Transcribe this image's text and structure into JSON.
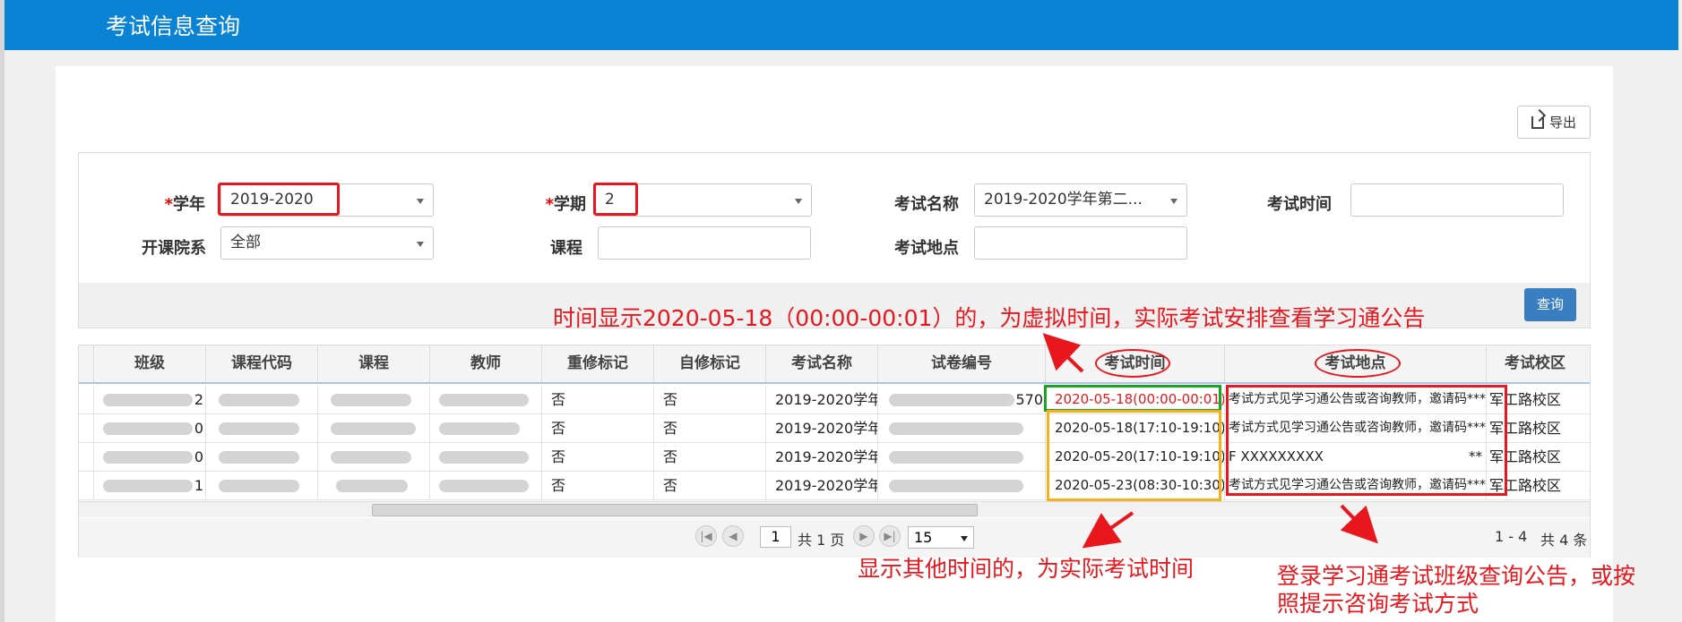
{
  "header": {
    "title": "考试信息查询"
  },
  "toolbar": {
    "export_label": "导出"
  },
  "filters": {
    "year_label": "学年",
    "year_value": "2019-2020",
    "term_label": "学期",
    "term_value": "2",
    "exam_name_label": "考试名称",
    "exam_name_value": "2019-2020学年第二...",
    "exam_time_label": "考试时间",
    "exam_time_value": "",
    "dept_label": "开课院系",
    "dept_value": "全部",
    "course_label": "课程",
    "course_value": "",
    "location_label": "考试地点",
    "location_value": "",
    "required_mark": "*"
  },
  "query_label": "查询",
  "annotations": {
    "top": "时间显示2020-05-18（00:00-00:01）的，为虚拟时间，实际考试安排查看学习通公告",
    "bottom_left": "显示其他时间的，为实际考试时间",
    "bottom_right_1": "登录学习通考试班级查询公告，或按",
    "bottom_right_2": "照提示咨询考试方式"
  },
  "table": {
    "columns": [
      "班级",
      "课程代码",
      "课程",
      "教师",
      "重修标记",
      "自修标记",
      "考试名称",
      "试卷编号",
      "考试时间",
      "考试地点",
      "考试校区"
    ],
    "rows": [
      {
        "class_suffix": "2",
        "code_suffix": "",
        "retake": "否",
        "self": "否",
        "exam_name": "2019-2020学年第",
        "paper": "570",
        "time": "2020-05-18(00:00-00:01)",
        "place": "考试方式见学习通公告或咨询教师，邀请码***",
        "campus": "军工路校区"
      },
      {
        "class_suffix": "0",
        "code_suffix": "",
        "retake": "否",
        "self": "否",
        "exam_name": "2019-2020学年第",
        "paper": "",
        "time": "2020-05-18(17:10-19:10)",
        "place": "考试方式见学习通公告或咨询教师，邀请码***",
        "campus": "军工路校区"
      },
      {
        "class_suffix": "0",
        "code_suffix": "",
        "retake": "否",
        "self": "否",
        "exam_name": "2019-2020学年第",
        "paper": "",
        "time": "2020-05-20(17:10-19:10)",
        "place": "F XXXXXXXXX",
        "place_tail": "**",
        "campus": "军工路校区"
      },
      {
        "class_suffix": "1",
        "code_suffix": "",
        "retake": "否",
        "self": "否",
        "exam_name": "2019-2020学年第",
        "paper": "",
        "time": "2020-05-23(08:30-10:30)",
        "place": "考试方式见学习通公告或咨询教师，邀请码***",
        "campus": "军工路校区"
      }
    ]
  },
  "pager": {
    "page": "1",
    "total_pages": "共 1 页",
    "page_size": "15",
    "range": "1 - 4",
    "total": "共 4 条"
  },
  "colors": {
    "accent": "#0a83d4",
    "annotation": "#e8171d",
    "green_box": "#19a51f",
    "orange_box": "#f5b01a"
  },
  "icons": [
    "export-icon",
    "first-page-icon",
    "prev-page-icon",
    "next-page-icon",
    "last-page-icon",
    "chevron-down-icon"
  ]
}
